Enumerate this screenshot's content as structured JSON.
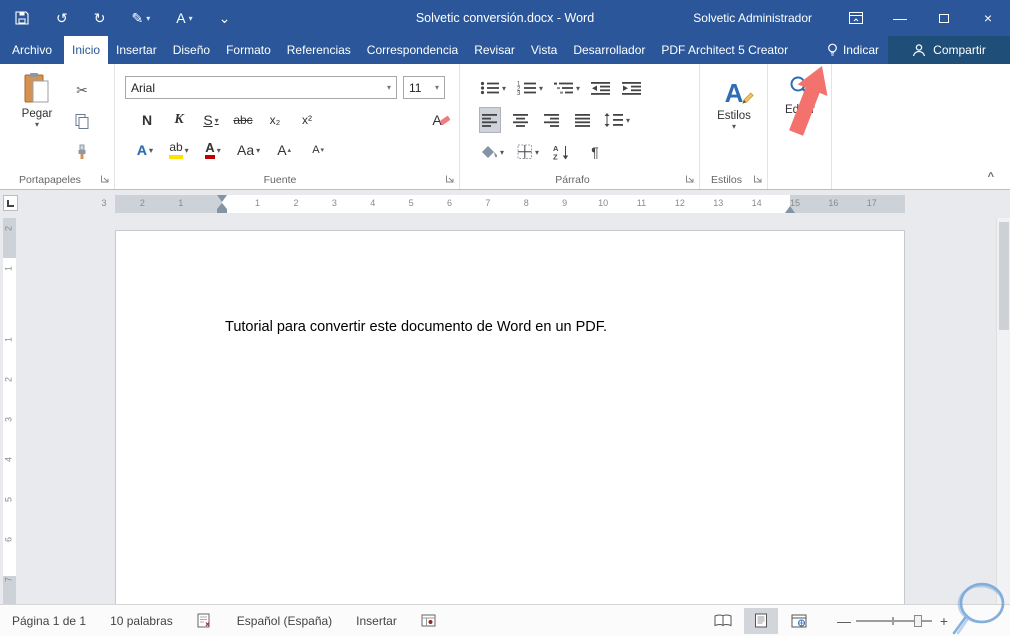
{
  "colors": {
    "titlebar_blue": "#2b579a",
    "share_panel_blue": "#1f4e79",
    "annotation_arrow": "#f3726d",
    "highlight_yellow": "#ffe100",
    "font_color_red": "#c00000",
    "styles_icon_blue": "#2e6db5",
    "doodle_blue": "#6fa3d8"
  },
  "titlebar": {
    "title": "Solvetic conversión.docx  -  Word",
    "user": "Solvetic Administrador"
  },
  "tabs": {
    "file": "Archivo",
    "items": [
      "Inicio",
      "Insertar",
      "Diseño",
      "Formato",
      "Referencias",
      "Correspondencia",
      "Revisar",
      "Vista",
      "Desarrollador",
      "PDF Architect 5 Creator"
    ],
    "active": "Inicio",
    "tell_me": "Indicar",
    "share": "Compartir"
  },
  "ribbon": {
    "clipboard": {
      "paste": "Pegar",
      "group": "Portapapeles"
    },
    "font": {
      "group": "Fuente",
      "name": "Arial",
      "size": "11",
      "bold": "N",
      "italic": "K",
      "underline": "S",
      "strikethrough": "abc",
      "subscript": "x₂",
      "superscript": "x²",
      "clear": "A",
      "effects": "A",
      "highlight": "ab",
      "color": "A",
      "change_case": "Aa",
      "grow": "A",
      "shrink": "A"
    },
    "paragraph": {
      "group": "Párrafo",
      "pilcrow": "¶",
      "sort_a": "A",
      "sort_z": "Z"
    },
    "styles": {
      "label": "Estilos",
      "group": "Estilos",
      "icon_letter": "A"
    },
    "editing": {
      "label": "Editar"
    }
  },
  "ruler": {
    "h_numbers": [
      "3",
      "2",
      "1",
      "",
      "1",
      "2",
      "3",
      "4",
      "5",
      "6",
      "7",
      "8",
      "9",
      "10",
      "11",
      "12",
      "13",
      "14",
      "15",
      "16",
      "17"
    ],
    "v_numbers": [
      "2",
      "1",
      "",
      "1",
      "2",
      "3",
      "4",
      "5",
      "6",
      "7"
    ]
  },
  "document": {
    "text": "Tutorial para convertir este documento de Word en un PDF."
  },
  "statusbar": {
    "page": "Página 1 de 1",
    "words": "10 palabras",
    "language": "Español (España)",
    "mode": "Insertar"
  },
  "glyphs": {
    "undo": "↺",
    "redo": "↻",
    "pen": "✎",
    "qat_letter": "A",
    "qat_more": "⌄",
    "minimize": "—",
    "close": "×",
    "scissors": "✂",
    "dropdown": "▾",
    "up": "▴",
    "collapse": "^",
    "zoom_out": "—",
    "zoom_in": "+"
  }
}
